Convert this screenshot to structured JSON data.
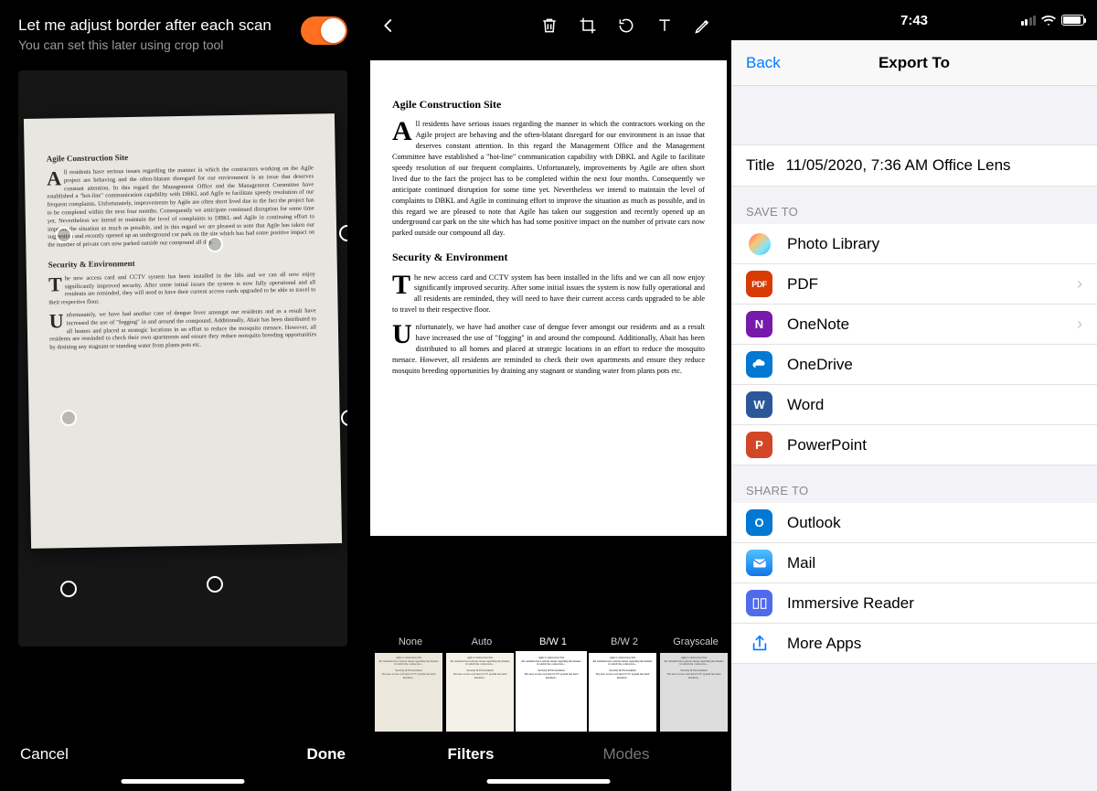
{
  "left": {
    "header_title": "Let me adjust border after each scan",
    "header_sub": "You can set this later using crop tool",
    "cancel": "Cancel",
    "done": "Done",
    "toggle_on": true,
    "document": {
      "section1_title": "Agile Construction Site",
      "para1": "ll residents have serious issues regarding the manner in which the contractors working on the Agile project are behaving and the often-blatant disregard for our environment is an issue that deserves constant attention. In this regard the Management Office and the Management Committee have established a \"hot-line\" communication capability with DBKL and Agile to facilitate speedy resolution of our frequent complaints. Unfortunately, improvements by Agile are often short lived due to the fact the project has to be completed within the next four months. Consequently we anticipate continued disruption for some time yet. Nevertheless we intend to maintain the level of complaints to DBKL and Agile in continuing effort to improve the situation as much as possible, and in this regard we are pleased to note that Agile has taken our suggestion and recently opened up an underground car park on the site which has had some positive impact on the number of private cars now parked outside our compound all day.",
      "section2_title": "Security & Environment",
      "para2": "he new access card and CCTV system has been installed in the lifts and we can all now enjoy significantly improved security. After some initial issues the system is now fully operational and all residents are reminded, they will need to have their current access cards upgraded to be able to travel to their respective floor.",
      "para3": "nfortunately, we have had another case of dengue fever amongst our residents and as a result have increased the use of \"fogging\" in and around the compound. Additionally, Abait has been distributed to all homes and placed at strategic locations in an effort to reduce the mosquito menace. However, all residents are reminded to check their own apartments and ensure they reduce mosquito breeding opportunities by draining any stagnant or standing water from plants pots etc."
    }
  },
  "mid": {
    "filters_label": "Filters",
    "modes_label": "Modes",
    "filters": {
      "none": "None",
      "auto": "Auto",
      "bw1": "B/W 1",
      "bw2": "B/W 2",
      "grayscale": "Grayscale"
    },
    "selected_filter": "bw1"
  },
  "right": {
    "status_time": "7:43",
    "back": "Back",
    "title": "Export To",
    "title_row_key": "Title",
    "title_row_value": "11/05/2020, 7:36 AM Office Lens",
    "save_to": "Save To",
    "share_to": "Share To",
    "items": {
      "photo_library": "Photo Library",
      "pdf": "PDF",
      "onenote": "OneNote",
      "onedrive": "OneDrive",
      "word": "Word",
      "powerpoint": "PowerPoint",
      "outlook": "Outlook",
      "mail": "Mail",
      "immersive_reader": "Immersive Reader",
      "more_apps": "More Apps"
    }
  }
}
